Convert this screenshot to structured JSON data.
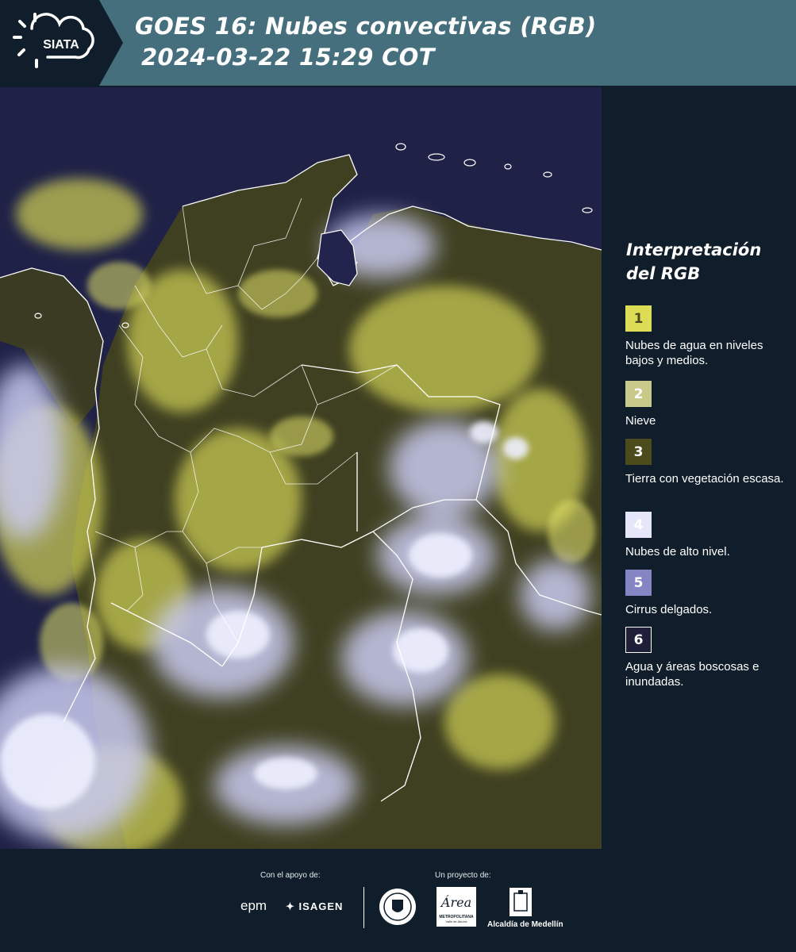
{
  "header": {
    "title_line1": "GOES 16: Nubes convectivas (RGB)",
    "title_line2": "2024-03-22 15:29 COT",
    "logo_text": "SIATA"
  },
  "colors": {
    "header_bg": "#466f7d",
    "page_bg": "#0f1e2a",
    "map_water": "#1f2147",
    "land_vegetation": "#4a4a1e",
    "low_cloud": "#d9d95a",
    "high_cloud": "#d8dcf5",
    "border": "#ffffff"
  },
  "legend": {
    "title": "Interpretación del RGB",
    "items": [
      {
        "number": "1",
        "label": "Nubes de agua en niveles bajos y medios.",
        "color": "#dcdc55",
        "text_color": "#4a4a1e"
      },
      {
        "number": "2",
        "label": "Nieve",
        "color": "#c9c98a",
        "text_color": "#ffffff"
      },
      {
        "number": "3",
        "label": "Tierra con vegetación escasa.",
        "color": "#4b4b1c",
        "text_color": "#ffffff"
      },
      {
        "number": "4",
        "label": "Nubes de alto nivel.",
        "color": "#e6e6fa",
        "text_color": "#ffffff"
      },
      {
        "number": "5",
        "label": "Cirrus delgados.",
        "color": "#8585c4",
        "text_color": "#ffffff"
      },
      {
        "number": "6",
        "label": "Agua y áreas boscosas e inundadas.",
        "color": "#1f1f3a",
        "text_color": "#ffffff"
      }
    ]
  },
  "footer": {
    "support_label": "Con el apoyo de:",
    "project_label": "Un proyecto de:",
    "sponsors": [
      "epm",
      "ISAGEN"
    ],
    "partners": [
      "METROPOLITANA",
      "Valle de Aburrá",
      "Alcaldía de Medellín"
    ],
    "area_script": "Área",
    "icons": [
      "siata-sun-logo",
      "epm-logo",
      "isagen-logo",
      "medellin-seal-logo",
      "area-metropolitana-logo",
      "alcaldia-building-logo"
    ]
  }
}
